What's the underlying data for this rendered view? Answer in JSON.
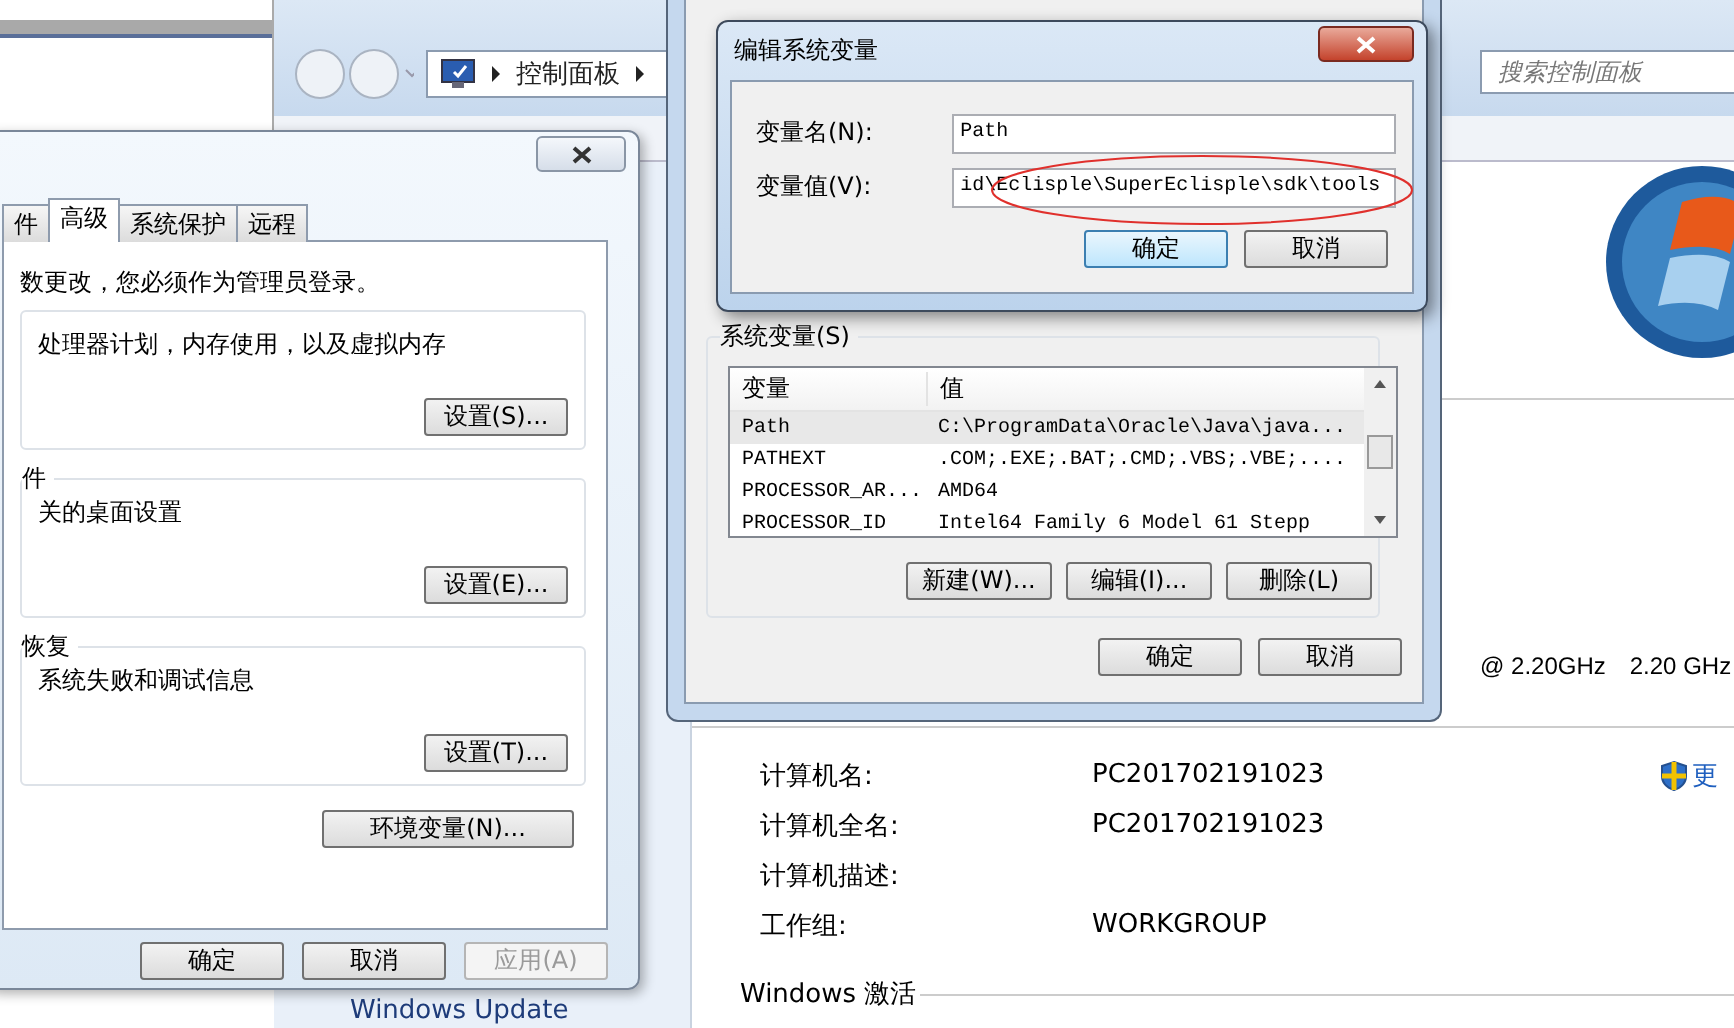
{
  "explorer": {
    "breadcrumb": [
      "控制面板"
    ],
    "search": {
      "placeholder": "搜索控制面板"
    },
    "processor_speed": "@ 2.20GHz",
    "processor_speed_2": "2.20 GHz",
    "computer_rows": [
      {
        "label": "计算机名:",
        "value": "PC201702191023"
      },
      {
        "label": "计算机全名:",
        "value": "PC201702191023"
      },
      {
        "label": "计算机描述:",
        "value": ""
      },
      {
        "label": "工作组:",
        "value": "WORKGROUP"
      }
    ],
    "change_link": "更",
    "activation_heading": "Windows 激活",
    "nav_link": "Windows Update"
  },
  "system_properties": {
    "tabs": [
      {
        "label": "件",
        "selected": false
      },
      {
        "label": "高级",
        "selected": true
      },
      {
        "label": "系统保护",
        "selected": false
      },
      {
        "label": "远程",
        "selected": false
      }
    ],
    "notice": "数更改，您必须作为管理员登录。",
    "groups": [
      {
        "text": "处理器计划，内存使用，以及虚拟内存",
        "button": "设置(S)..."
      },
      {
        "title": "件",
        "text": "关的桌面设置",
        "button": "设置(E)..."
      },
      {
        "title": "恢复",
        "text": "系统失败和调试信息",
        "button": "设置(T)..."
      }
    ],
    "env_button": "环境变量(N)...",
    "buttons": [
      {
        "label": "确定",
        "disabled": false
      },
      {
        "label": "取消",
        "disabled": false
      },
      {
        "label": "应用(A)",
        "disabled": true
      }
    ]
  },
  "environment_variables": {
    "group_title": "系统变量(S)",
    "columns": [
      "变量",
      "值"
    ],
    "rows": [
      {
        "name": "Path",
        "value": "C:\\ProgramData\\Oracle\\Java\\java...",
        "selected": true
      },
      {
        "name": "PATHEXT",
        "value": ".COM;.EXE;.BAT;.CMD;.VBS;.VBE;....",
        "selected": false
      },
      {
        "name": "PROCESSOR_AR...",
        "value": "AMD64",
        "selected": false
      },
      {
        "name": "PROCESSOR_ID",
        "value": "Intel64 Family 6 Model 61 Stepp",
        "selected": false
      }
    ],
    "list_buttons": [
      "新建(W)...",
      "编辑(I)...",
      "删除(L)"
    ],
    "buttons": [
      "确定",
      "取消"
    ]
  },
  "edit_dialog": {
    "title": "编辑系统变量",
    "fields": [
      {
        "label": "变量名(N):",
        "value": "Path"
      },
      {
        "label": "变量值(V):",
        "value": "id\\Eclisple\\SuperEclisple\\sdk\\tools"
      }
    ],
    "buttons": [
      {
        "label": "确定",
        "default": true
      },
      {
        "label": "取消",
        "default": false
      }
    ]
  }
}
